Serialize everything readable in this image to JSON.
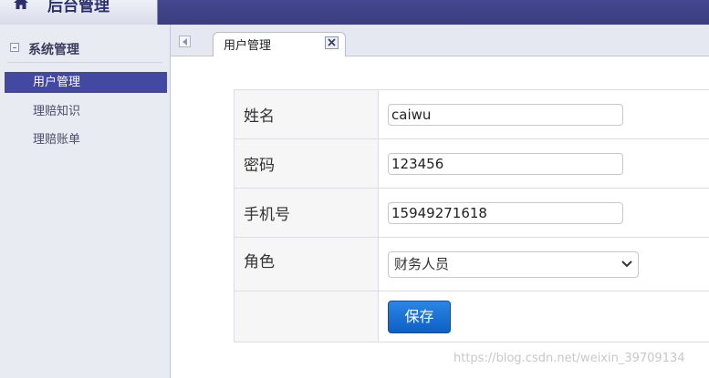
{
  "app": {
    "title": "后台管理"
  },
  "sidebar": {
    "group_label": "系统管理",
    "items": [
      {
        "label": "用户管理",
        "active": true
      },
      {
        "label": "理赔知识",
        "active": false
      },
      {
        "label": "理赔账单",
        "active": false
      }
    ]
  },
  "tabs": [
    {
      "label": "用户管理"
    }
  ],
  "form": {
    "name_label": "姓名",
    "name_value": "caiwu",
    "password_label": "密码",
    "password_value": "123456",
    "phone_label": "手机号",
    "phone_value": "15949271618",
    "role_label": "角色",
    "role_value": "财务人员",
    "save_label": "保存"
  },
  "watermark": "https://blog.csdn.net/weixin_39709134",
  "colors": {
    "accent": "#4348a0",
    "topbar": "#3b3d80",
    "button": "#1a6fd4"
  }
}
